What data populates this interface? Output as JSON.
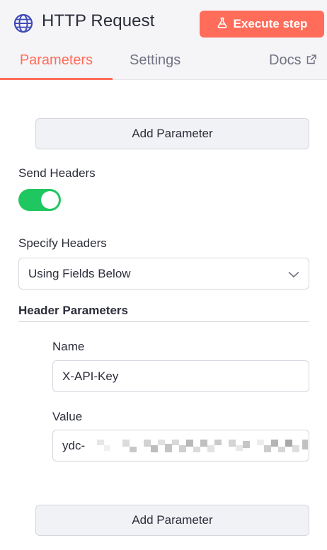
{
  "header": {
    "icon": "globe-icon",
    "title": "HTTP Request",
    "execute_label": "Execute step",
    "execute_icon": "flask-icon",
    "accent": "#ff6d5a"
  },
  "tabs": [
    {
      "label": "Parameters",
      "active": true
    },
    {
      "label": "Settings",
      "active": false
    },
    {
      "label": "Docs",
      "icon": "external-link-icon",
      "active": false
    }
  ],
  "form": {
    "add_parameter_top": "Add Parameter",
    "send_headers_label": "Send Headers",
    "send_headers_on": true,
    "specify_headers_label": "Specify Headers",
    "specify_headers_value": "Using Fields Below",
    "header_parameters_label": "Header Parameters",
    "name_label": "Name",
    "name_value": "X-API-Key",
    "value_label": "Value",
    "value_value": "ydc-",
    "add_parameter_bottom": "Add Parameter",
    "toggle_color": "#1fc760"
  }
}
